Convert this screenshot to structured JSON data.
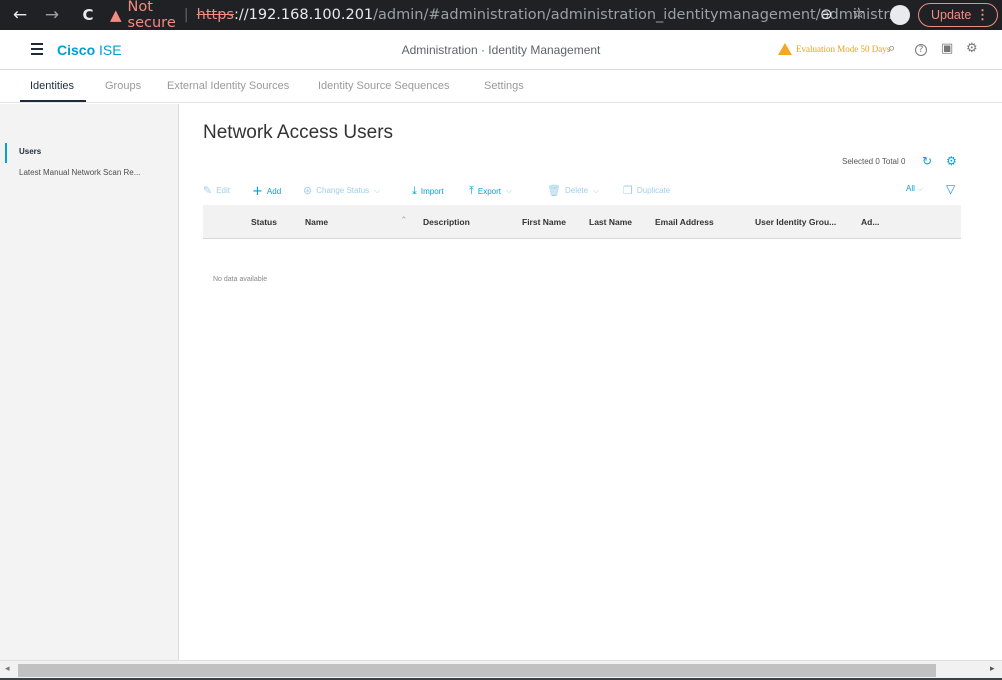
{
  "browser": {
    "back_icon": "←",
    "forward_icon": "→",
    "reload_icon": "C",
    "warning_icon": "▲",
    "not_secure": "Not secure",
    "url_scheme": "https",
    "url_host": "://192.168.100.201",
    "url_path": "/admin/#administration/administration_identitymanagement/administr...",
    "zoom_icon": "⊖",
    "star_icon": "☆",
    "update_label": "Update",
    "menu_icon": "⋮"
  },
  "header": {
    "brand_bold": "Cisco",
    "brand_rest": " ISE",
    "breadcrumb": "Administration · Identity Management",
    "evaluation_text": "Evaluation Mode 50 Days",
    "search_icon": "⌕",
    "help_icon": "?",
    "dashboard_icon": "▣",
    "settings_icon": "⚙"
  },
  "tabs": [
    {
      "label": "Identities",
      "active": true
    },
    {
      "label": "Groups",
      "active": false
    },
    {
      "label": "External Identity Sources",
      "active": false
    },
    {
      "label": "Identity Source Sequences",
      "active": false
    },
    {
      "label": "Settings",
      "active": false
    }
  ],
  "sidebar": {
    "items": [
      {
        "label": "Users",
        "active": true
      },
      {
        "label": "Latest Manual Network Scan Re...",
        "active": false
      }
    ]
  },
  "main": {
    "title": "Network Access Users",
    "selected_total": "Selected 0  Total 0",
    "refresh_icon": "↻",
    "gear_icon": "⚙",
    "toolbar": {
      "edit": "Edit",
      "add": "Add",
      "change_status": "Change Status",
      "import": "Import",
      "export": "Export",
      "delete": "Delete",
      "duplicate": "Duplicate",
      "filter_all": "All",
      "filter_icon": "▽"
    },
    "columns": [
      "Status",
      "Name",
      "Description",
      "First Name",
      "Last Name",
      "Email Address",
      "User Identity Grou...",
      "Ad..."
    ],
    "empty_message": "No data available"
  },
  "colors": {
    "accent": "#049fd9",
    "warning": "#f5a623",
    "not_secure": "#f28b82"
  }
}
